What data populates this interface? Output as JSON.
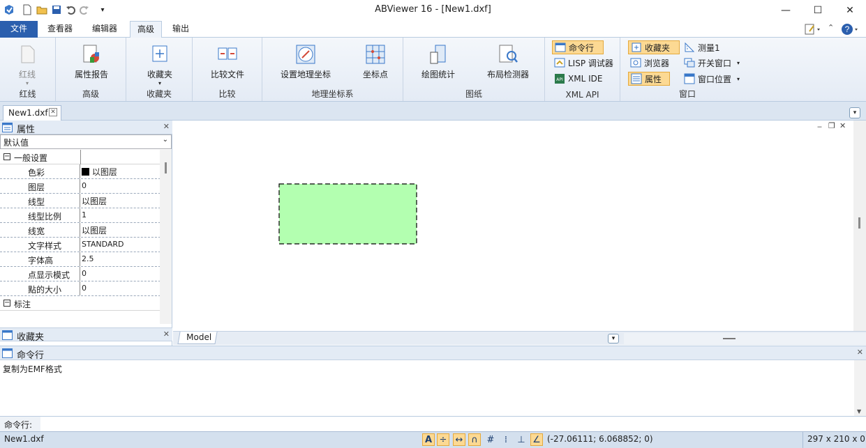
{
  "window": {
    "title": "ABViewer 16 - [New1.dxf]",
    "minimize": "—",
    "maximize": "☐",
    "close": "✕"
  },
  "ribbon_tabs": [
    "文件",
    "查看器",
    "编辑器",
    "高级",
    "输出"
  ],
  "ribbon_right": {
    "help": "?"
  },
  "ribbon": {
    "groups": [
      {
        "label": "红线",
        "buttons": [
          "红线"
        ]
      },
      {
        "label": "高级",
        "buttons": [
          "属性报告"
        ]
      },
      {
        "label": "收藏夹",
        "buttons": [
          "收藏夹"
        ]
      },
      {
        "label": "比较",
        "buttons": [
          "比较文件"
        ]
      },
      {
        "label": "地理坐标系",
        "buttons": [
          "设置地理坐标",
          "坐标点"
        ]
      },
      {
        "label": "图纸",
        "buttons": [
          "绘图统计",
          "布局检测器"
        ]
      },
      {
        "label": "XML API",
        "buttons": [
          "命令行",
          "LISP 调试器",
          "XML IDE"
        ]
      },
      {
        "label": "窗口",
        "buttons": [
          "收藏夹",
          "浏览器",
          "属性",
          "测量1",
          "开关窗口",
          "窗口位置"
        ]
      }
    ]
  },
  "doc_tab": "New1.dxf",
  "properties_panel": {
    "title": "属性",
    "combo_value": "默认值",
    "category_general": "一般设置",
    "rows": [
      {
        "name": "色彩",
        "value": "以图层"
      },
      {
        "name": "图层",
        "value": "0"
      },
      {
        "name": "线型",
        "value": "以图层"
      },
      {
        "name": "线型比例",
        "value": "1"
      },
      {
        "name": "线宽",
        "value": "以图层"
      },
      {
        "name": "文字样式",
        "value": "STANDARD"
      },
      {
        "name": "字体高",
        "value": "2.5"
      },
      {
        "name": "点显示模式",
        "value": "0"
      },
      {
        "name": "點的大小",
        "value": "0"
      }
    ],
    "category_dim": "标注"
  },
  "favorites_panel": {
    "title": "收藏夹"
  },
  "model_tab": "Model",
  "command_panel": {
    "title": "命令行",
    "output": "复制为EMF格式",
    "prompt": "命令行:"
  },
  "status": {
    "file": "New1.dxf",
    "coords": "(-27.06111; 6.068852; 0)",
    "paper": "297 x 210 x 0"
  },
  "colors": {
    "accent": "#2b5fae",
    "rect_fill": "#b3ffb0",
    "highlight": "#fcd993"
  }
}
